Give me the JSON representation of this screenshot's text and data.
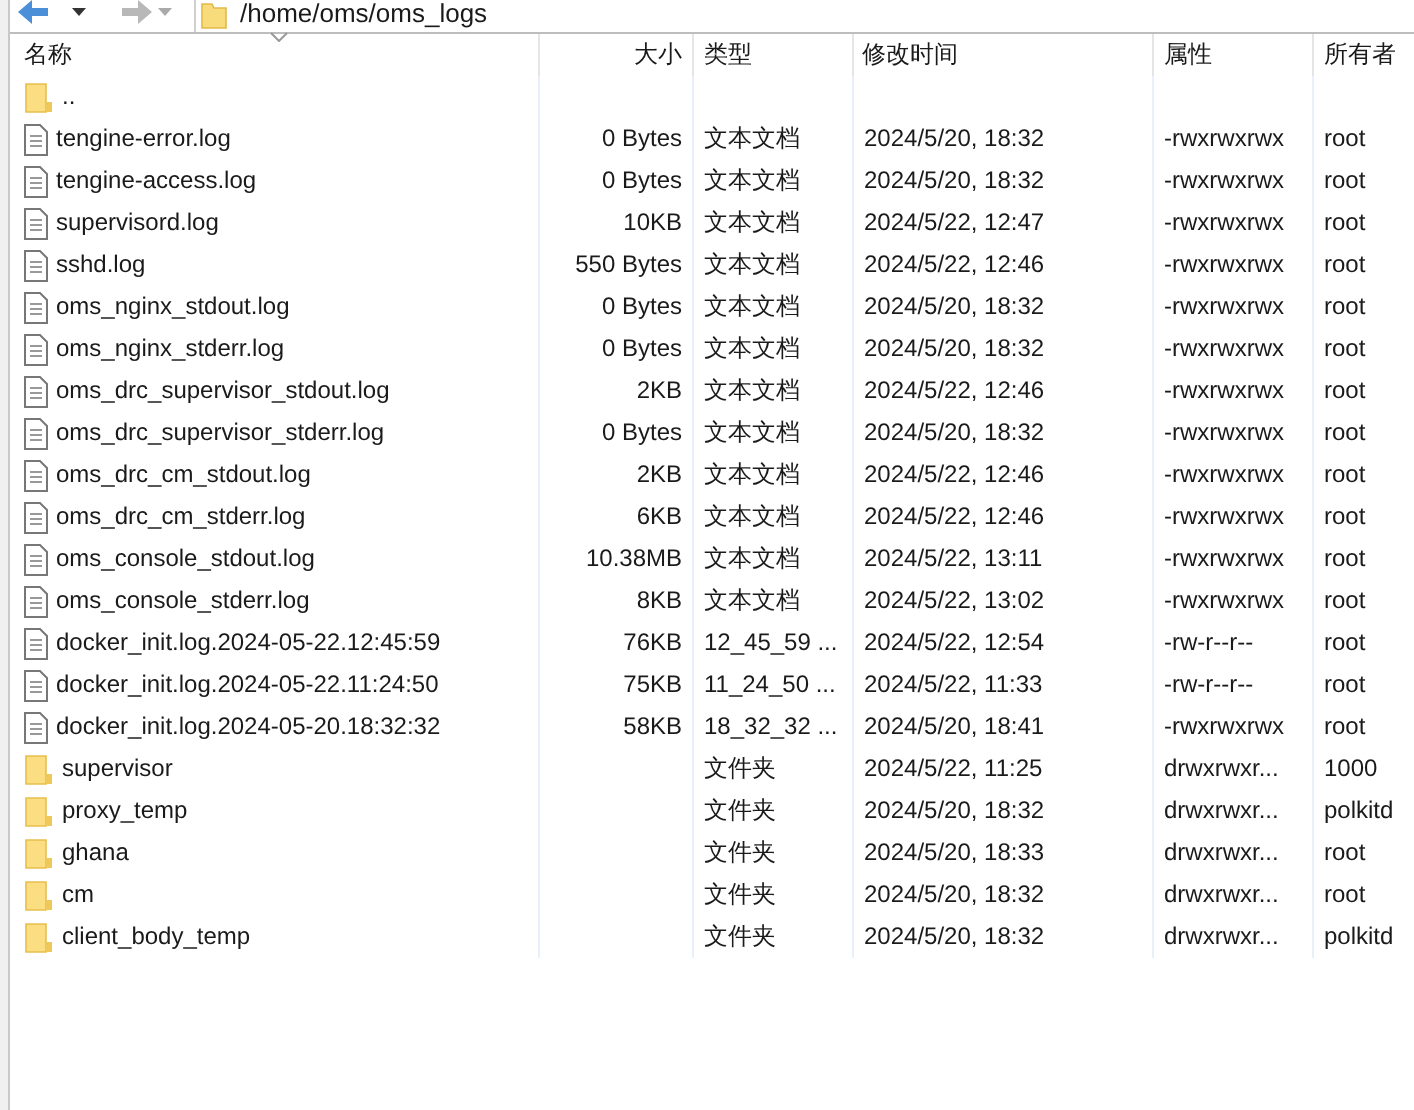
{
  "toolbar": {
    "path": "/home/oms/oms_logs"
  },
  "table": {
    "columns": [
      "名称",
      "大小",
      "类型",
      "修改时间",
      "属性",
      "所有者"
    ],
    "rows": [
      {
        "kind": "folder",
        "name": "..",
        "size": "",
        "type": "",
        "modified": "",
        "permissions": "",
        "owner": ""
      },
      {
        "kind": "file",
        "name": "tengine-error.log",
        "size": "0 Bytes",
        "type": "文本文档",
        "modified": "2024/5/20, 18:32",
        "permissions": "-rwxrwxrwx",
        "owner": "root"
      },
      {
        "kind": "file",
        "name": "tengine-access.log",
        "size": "0 Bytes",
        "type": "文本文档",
        "modified": "2024/5/20, 18:32",
        "permissions": "-rwxrwxrwx",
        "owner": "root"
      },
      {
        "kind": "file",
        "name": "supervisord.log",
        "size": "10KB",
        "type": "文本文档",
        "modified": "2024/5/22, 12:47",
        "permissions": "-rwxrwxrwx",
        "owner": "root"
      },
      {
        "kind": "file",
        "name": "sshd.log",
        "size": "550 Bytes",
        "type": "文本文档",
        "modified": "2024/5/22, 12:46",
        "permissions": "-rwxrwxrwx",
        "owner": "root"
      },
      {
        "kind": "file",
        "name": "oms_nginx_stdout.log",
        "size": "0 Bytes",
        "type": "文本文档",
        "modified": "2024/5/20, 18:32",
        "permissions": "-rwxrwxrwx",
        "owner": "root"
      },
      {
        "kind": "file",
        "name": "oms_nginx_stderr.log",
        "size": "0 Bytes",
        "type": "文本文档",
        "modified": "2024/5/20, 18:32",
        "permissions": "-rwxrwxrwx",
        "owner": "root"
      },
      {
        "kind": "file",
        "name": "oms_drc_supervisor_stdout.log",
        "size": "2KB",
        "type": "文本文档",
        "modified": "2024/5/22, 12:46",
        "permissions": "-rwxrwxrwx",
        "owner": "root"
      },
      {
        "kind": "file",
        "name": "oms_drc_supervisor_stderr.log",
        "size": "0 Bytes",
        "type": "文本文档",
        "modified": "2024/5/20, 18:32",
        "permissions": "-rwxrwxrwx",
        "owner": "root"
      },
      {
        "kind": "file",
        "name": "oms_drc_cm_stdout.log",
        "size": "2KB",
        "type": "文本文档",
        "modified": "2024/5/22, 12:46",
        "permissions": "-rwxrwxrwx",
        "owner": "root"
      },
      {
        "kind": "file",
        "name": "oms_drc_cm_stderr.log",
        "size": "6KB",
        "type": "文本文档",
        "modified": "2024/5/22, 12:46",
        "permissions": "-rwxrwxrwx",
        "owner": "root"
      },
      {
        "kind": "file",
        "name": "oms_console_stdout.log",
        "size": "10.38MB",
        "type": "文本文档",
        "modified": "2024/5/22, 13:11",
        "permissions": "-rwxrwxrwx",
        "owner": "root"
      },
      {
        "kind": "file",
        "name": "oms_console_stderr.log",
        "size": "8KB",
        "type": "文本文档",
        "modified": "2024/5/22, 13:02",
        "permissions": "-rwxrwxrwx",
        "owner": "root"
      },
      {
        "kind": "file",
        "name": "docker_init.log.2024-05-22.12:45:59",
        "size": "76KB",
        "type": "12_45_59 ...",
        "modified": "2024/5/22, 12:54",
        "permissions": "-rw-r--r--",
        "owner": "root"
      },
      {
        "kind": "file",
        "name": "docker_init.log.2024-05-22.11:24:50",
        "size": "75KB",
        "type": "11_24_50 ...",
        "modified": "2024/5/22, 11:33",
        "permissions": "-rw-r--r--",
        "owner": "root"
      },
      {
        "kind": "file",
        "name": "docker_init.log.2024-05-20.18:32:32",
        "size": "58KB",
        "type": "18_32_32 ...",
        "modified": "2024/5/20, 18:41",
        "permissions": "-rwxrwxrwx",
        "owner": "root"
      },
      {
        "kind": "folder",
        "name": "supervisor",
        "size": "",
        "type": "文件夹",
        "modified": "2024/5/22, 11:25",
        "permissions": "drwxrwxr...",
        "owner": "1000"
      },
      {
        "kind": "folder",
        "name": "proxy_temp",
        "size": "",
        "type": "文件夹",
        "modified": "2024/5/20, 18:32",
        "permissions": "drwxrwxr...",
        "owner": "polkitd"
      },
      {
        "kind": "folder",
        "name": "ghana",
        "size": "",
        "type": "文件夹",
        "modified": "2024/5/20, 18:33",
        "permissions": "drwxrwxr...",
        "owner": "root"
      },
      {
        "kind": "folder",
        "name": "cm",
        "size": "",
        "type": "文件夹",
        "modified": "2024/5/20, 18:32",
        "permissions": "drwxrwxr...",
        "owner": "root"
      },
      {
        "kind": "folder",
        "name": "client_body_temp",
        "size": "",
        "type": "文件夹",
        "modified": "2024/5/20, 18:32",
        "permissions": "drwxrwxr...",
        "owner": "polkitd"
      }
    ]
  }
}
